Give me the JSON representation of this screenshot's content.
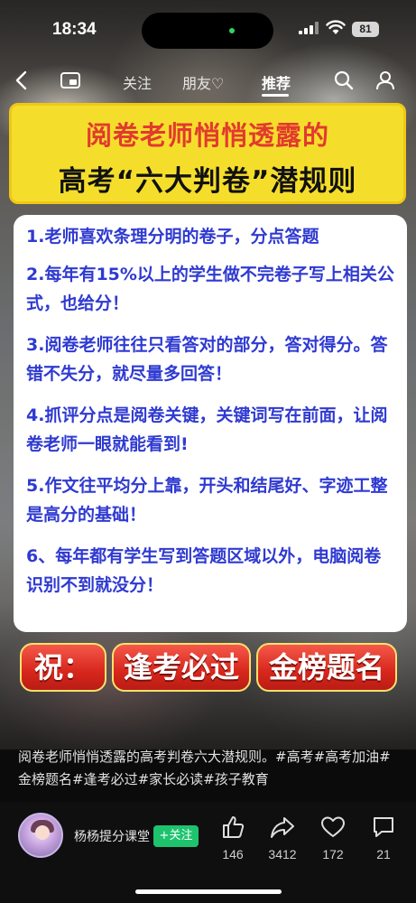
{
  "status_bar": {
    "time": "18:34",
    "battery": "81"
  },
  "nav": {
    "tabs": [
      {
        "label": "关注",
        "active": false
      },
      {
        "label": "朋友♡",
        "active": false
      },
      {
        "label": "推荐",
        "active": true
      }
    ]
  },
  "post": {
    "title_line1": "阅卷老师悄悄透露的",
    "title_line2": "高考“六大判卷”潜规则",
    "rules": [
      "1.老师喜欢条理分明的卷子，分点答题",
      "2.每年有15%以上的学生做不完卷子写上相关公式，也给分！",
      "3.阅卷老师往往只看答对的部分，答对得分。答错不失分，就尽量多回答！",
      "4.抓评分点是阅卷关键，关键词写在前面，让阅卷老师一眼就能看到!",
      "5.作文往平均分上靠，开头和结尾好、字迹工整是高分的基础！",
      "6、每年都有学生写到答题区域以外，电脑阅卷识别不到就没分！"
    ],
    "blessing": {
      "prefix": "祝：",
      "phrase1": "逢考必过",
      "phrase2": "金榜题名"
    },
    "caption": "阅卷老师悄悄透露的高考判卷六大潜规则。#高考#高考加油#金榜题名#逢考必过#家长必读#孩子教育"
  },
  "author": {
    "name": "杨杨提分课堂",
    "follow_label": "+关注"
  },
  "actions": {
    "likes": "146",
    "shares": "3412",
    "favorites": "172",
    "comments": "21"
  },
  "colors": {
    "title_bg": "#f5de2b",
    "title_accent": "#e23a2f",
    "rule_text": "#2f3ad1",
    "blessing_bg": "#d8261c",
    "follow_bg": "#1ec36d"
  },
  "icons": [
    "back-icon",
    "mini-window-icon",
    "search-icon",
    "user-icon",
    "thumbs-up-icon",
    "share-icon",
    "heart-icon",
    "comment-icon"
  ]
}
